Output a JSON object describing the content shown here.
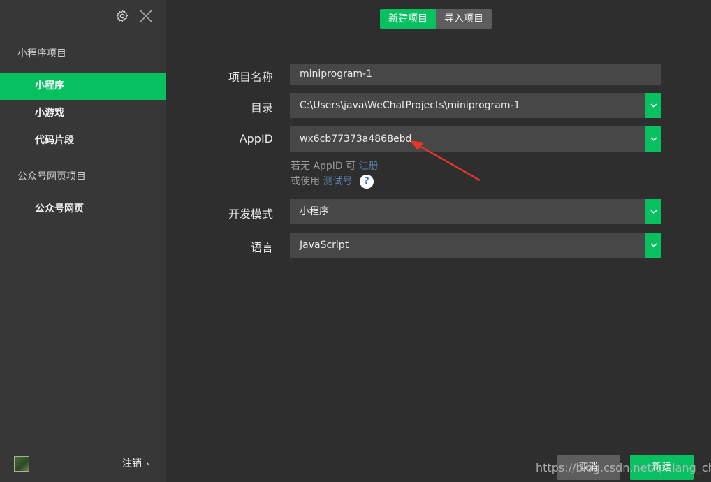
{
  "sidebar": {
    "section1_title": "小程序项目",
    "items": [
      {
        "label": "小程序",
        "active": true
      },
      {
        "label": "小游戏",
        "active": false
      },
      {
        "label": "代码片段",
        "active": false
      }
    ],
    "section2_title": "公众号网页项目",
    "items2": [
      {
        "label": "公众号网页",
        "active": false
      }
    ],
    "logout_label": "注销",
    "logout_chevron": "›"
  },
  "header": {
    "tabs": [
      {
        "label": "新建项目",
        "active": true
      },
      {
        "label": "导入项目",
        "active": false
      }
    ]
  },
  "form": {
    "project_name": {
      "label": "项目名称",
      "value": "miniprogram-1"
    },
    "directory": {
      "label": "目录",
      "value": "C:\\Users\\java\\WeChatProjects\\miniprogram-1"
    },
    "appid": {
      "label": "AppID",
      "value": "wx6cb77373a4868ebd"
    },
    "hint1_prefix": "若无 AppID 可",
    "hint1_link": "注册",
    "hint2_prefix": "或使用",
    "hint2_link": "测试号",
    "help_glyph": "?",
    "dev_mode": {
      "label": "开发模式",
      "value": "小程序"
    },
    "language": {
      "label": "语言",
      "value": "JavaScript"
    }
  },
  "footer": {
    "cancel_label": "取消",
    "create_label": "新建"
  },
  "watermark": "https://blog.csdn.net/qixiang_chen",
  "colors": {
    "accent": "#07c160",
    "sidebar_bg": "#373737",
    "main_bg": "#2e2e2e",
    "field_bg": "#474747",
    "annotation_arrow": "#e8362b"
  }
}
